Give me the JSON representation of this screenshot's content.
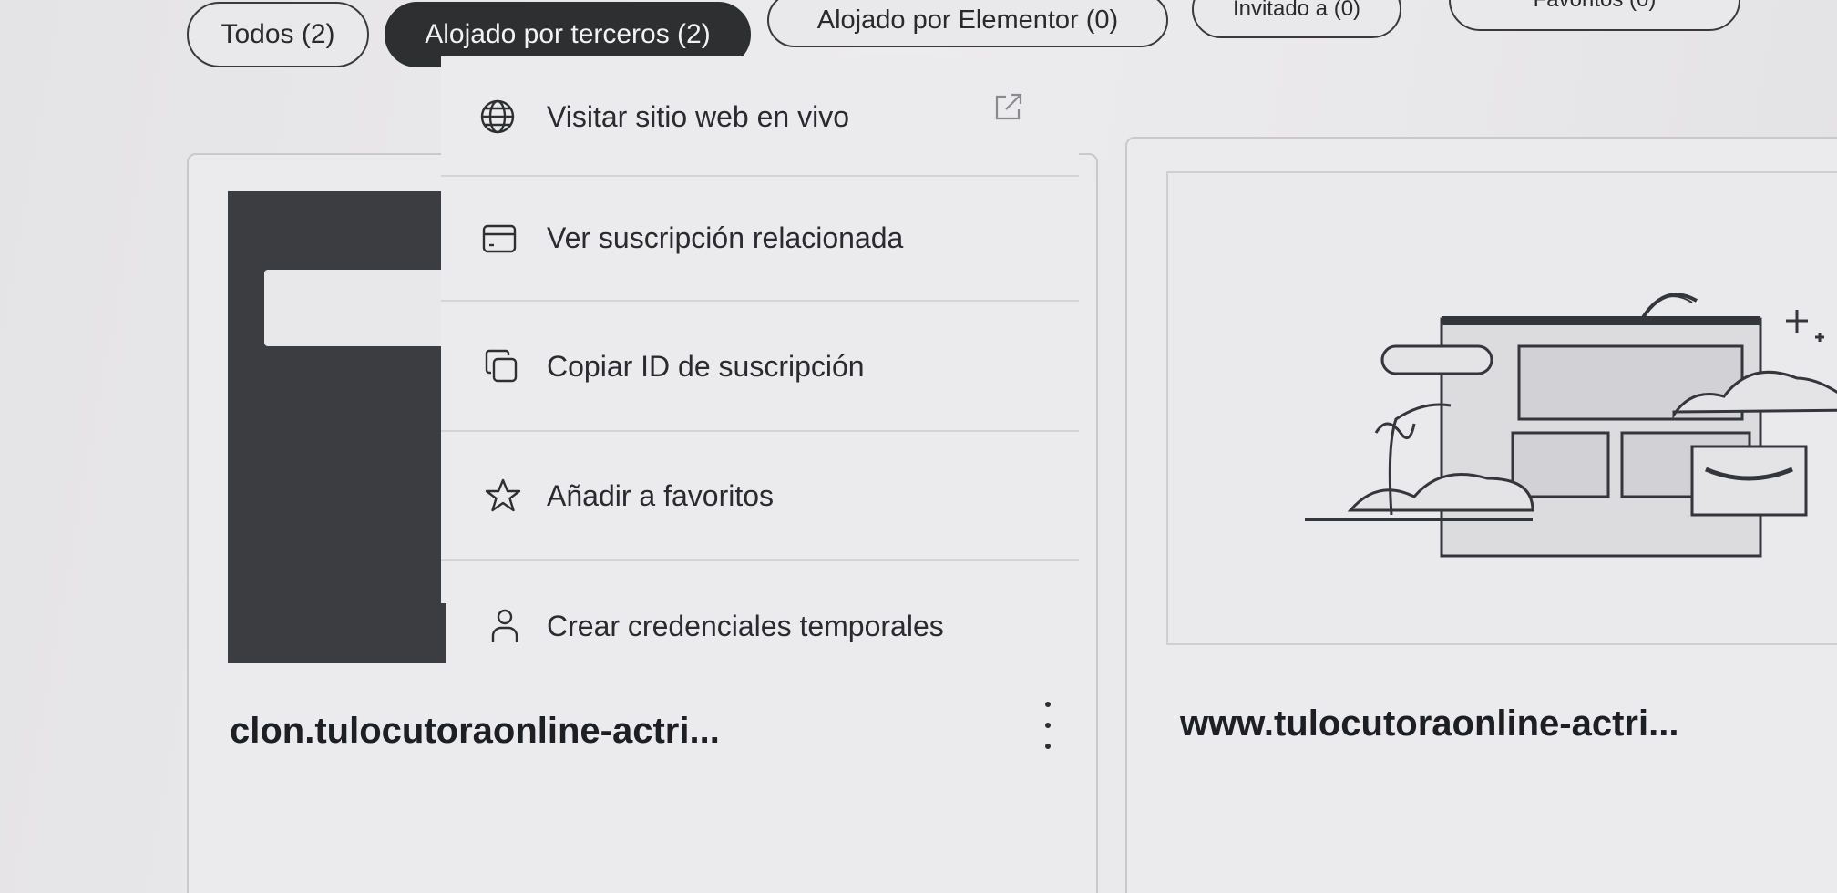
{
  "filters": {
    "all": "Todos (2)",
    "third_party": "Alojado por terceros (2)",
    "elementor": "Alojado por Elementor (0)",
    "invited": "Invitado a (0)",
    "favorites": "Favoritos (0)"
  },
  "menu": {
    "items": [
      {
        "label": "Visitar sitio web en vivo",
        "icon": "globe-icon"
      },
      {
        "label": "Ver suscripción relacionada",
        "icon": "credit-card-icon"
      },
      {
        "label": "Copiar ID de suscripción",
        "icon": "copy-icon"
      },
      {
        "label": "Añadir a favoritos",
        "icon": "star-icon"
      },
      {
        "label": "Crear credenciales temporales",
        "icon": "user-icon"
      }
    ]
  },
  "cards": [
    {
      "title": "clon.tulocutoraonline-actri..."
    },
    {
      "title": "www.tulocutoraonline-actri..."
    }
  ],
  "colors": {
    "active_pill": "#2e2f31",
    "background": "#e7e6e8",
    "thumbnail_dark": "#3b3d40"
  }
}
